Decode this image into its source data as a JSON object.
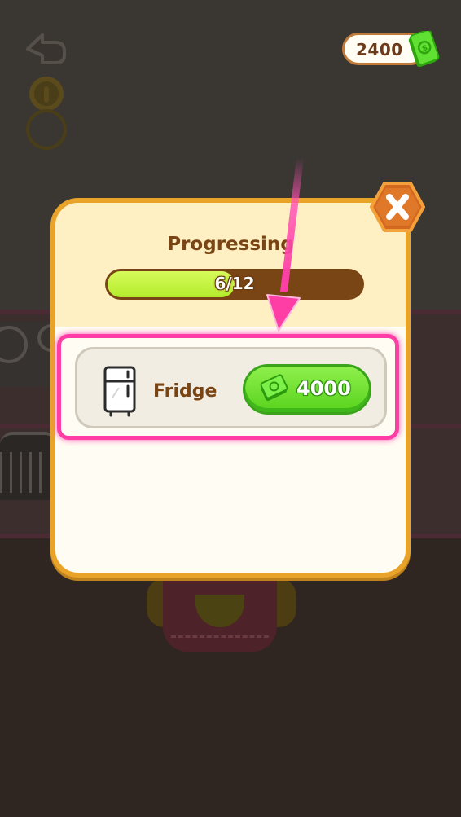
{
  "hud": {
    "back_icon": "back-arrow-icon",
    "currency_amount": "2400",
    "currency_icon": "cash-icon"
  },
  "modal": {
    "title": "Progressing",
    "progress": {
      "current": 6,
      "total": 12,
      "fraction": 0.5,
      "label": "6/12"
    },
    "close_icon": "close-x-icon",
    "items": [
      {
        "name": "Fridge",
        "icon": "fridge-icon",
        "price": "4000",
        "price_icon": "cash-icon",
        "highlighted": true
      }
    ]
  },
  "tutorial": {
    "pointer_icon": "pointer-arrow-icon",
    "highlight_color": "#ff3ea5"
  },
  "colors": {
    "panel_border": "#e9a328",
    "panel_header": "#fff0c4",
    "progress_fill": "#c4f23e",
    "progress_track": "#7a4514",
    "buy_button": "#6fe02e",
    "text_brown": "#7a4514"
  }
}
